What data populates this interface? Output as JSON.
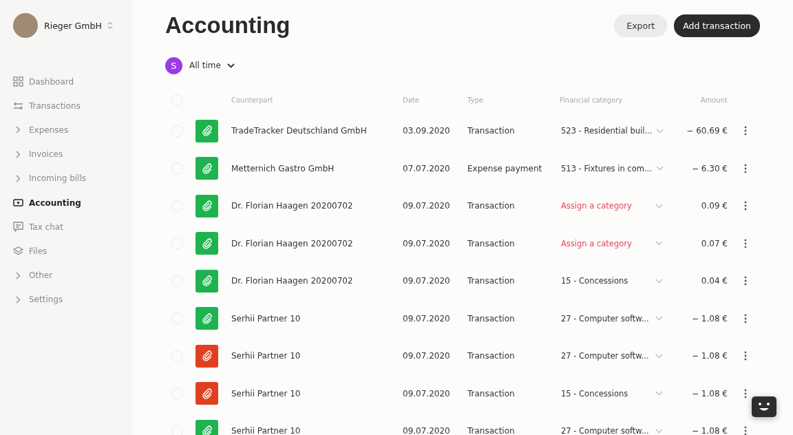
{
  "account": {
    "name": "Rieger GmbH"
  },
  "sidebar": {
    "items": [
      {
        "label": "Dashboard",
        "kind": "grid",
        "selected": false
      },
      {
        "label": "Transactions",
        "kind": "arrows",
        "selected": false
      },
      {
        "label": "Expenses",
        "kind": "group",
        "selected": false
      },
      {
        "label": "Invoices",
        "kind": "group",
        "selected": false
      },
      {
        "label": "Incoming bills",
        "kind": "group",
        "selected": false
      },
      {
        "label": "Accounting",
        "kind": "cash",
        "selected": true
      },
      {
        "label": "Tax chat",
        "kind": "chat",
        "selected": false
      },
      {
        "label": "Files",
        "kind": "layers",
        "selected": false
      },
      {
        "label": "Other",
        "kind": "group",
        "selected": false
      },
      {
        "label": "Settings",
        "kind": "group",
        "selected": false
      }
    ]
  },
  "page": {
    "title": "Accounting",
    "buttons": [
      {
        "label": "Export",
        "kind": "secondary"
      },
      {
        "label": "Add transaction",
        "kind": "primary"
      }
    ]
  },
  "filter": {
    "avatar_letter": "S",
    "period": "All time"
  },
  "table": {
    "all_checked": false,
    "columns": [
      "Counterpart",
      "Date",
      "Type",
      "Financial category",
      "Amount"
    ],
    "rows": [
      {
        "checked": false,
        "counterpart": "TradeTracker Deutschland GmbH",
        "date": "03.09.2020",
        "type": "Transaction",
        "category": "523 - Residential buil...",
        "unassigned": false,
        "amount": "− 60.69 €",
        "color": "#1fb34f"
      },
      {
        "checked": false,
        "counterpart": "Metternich Gastro GmbH",
        "date": "07.07.2020",
        "type": "Expense payment",
        "category": "513 - Fixtures in com...",
        "unassigned": false,
        "amount": "− 6.30 €",
        "color": "#1fb34f"
      },
      {
        "checked": false,
        "counterpart": "Dr. Florian Haagen 20200702",
        "date": "09.07.2020",
        "type": "Transaction",
        "category": "Assign a category",
        "unassigned": true,
        "amount": "0.09 €",
        "color": "#1fb34f"
      },
      {
        "checked": false,
        "counterpart": "Dr. Florian Haagen 20200702",
        "date": "09.07.2020",
        "type": "Transaction",
        "category": "Assign a category",
        "unassigned": true,
        "amount": "0.07 €",
        "color": "#1fb34f"
      },
      {
        "checked": false,
        "counterpart": "Dr. Florian Haagen 20200702",
        "date": "09.07.2020",
        "type": "Transaction",
        "category": "15 - Concessions",
        "unassigned": false,
        "amount": "0.04 €",
        "color": "#1fb34f"
      },
      {
        "checked": false,
        "counterpart": "Serhii Partner 10",
        "date": "09.07.2020",
        "type": "Transaction",
        "category": "27 - Computer softw...",
        "unassigned": false,
        "amount": "− 1.08 €",
        "color": "#1fb34f"
      },
      {
        "checked": false,
        "counterpart": "Serhii Partner 10",
        "date": "09.07.2020",
        "type": "Transaction",
        "category": "27 - Computer softw...",
        "unassigned": false,
        "amount": "− 1.08 €",
        "color": "#e0401f"
      },
      {
        "checked": false,
        "counterpart": "Serhii Partner 10",
        "date": "09.07.2020",
        "type": "Transaction",
        "category": "15 - Concessions",
        "unassigned": false,
        "amount": "− 1.08 €",
        "color": "#e0401f"
      },
      {
        "checked": false,
        "counterpart": "Serhii Partner 10",
        "date": "09.07.2020",
        "type": "Transaction",
        "category": "27 - Computer softw...",
        "unassigned": false,
        "amount": "− 1.08 €",
        "color": "#1fb34f"
      }
    ]
  }
}
